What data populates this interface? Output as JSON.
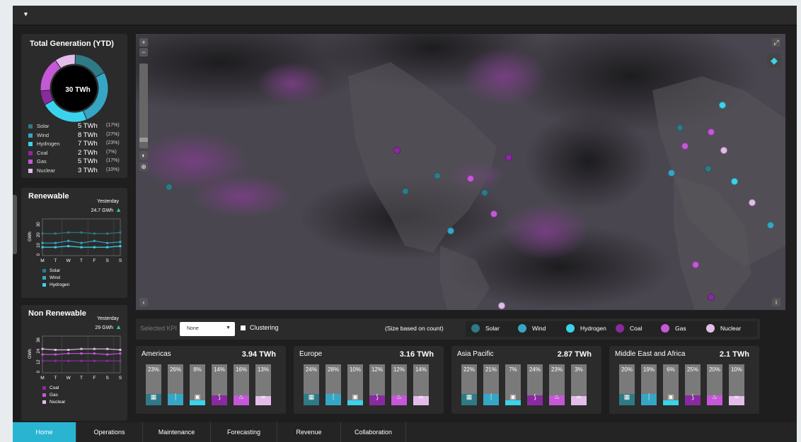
{
  "total_generation": {
    "title": "Total Generation (YTD)",
    "center_label": "30 TWh",
    "legend": [
      {
        "name": "Solar",
        "value": "5 TWh",
        "pct": "(17%)",
        "color": "#2e7a86"
      },
      {
        "name": "Wind",
        "value": "8 TWh",
        "pct": "(27%)",
        "color": "#36a6c4"
      },
      {
        "name": "Hydrogen",
        "value": "7 TWh",
        "pct": "(23%)",
        "color": "#3ad3ec"
      },
      {
        "name": "Coal",
        "value": "2 TWh",
        "pct": "(7%)",
        "color": "#8a2aa0"
      },
      {
        "name": "Gas",
        "value": "5 TWh",
        "pct": "(17%)",
        "color": "#c458d6"
      },
      {
        "name": "Nuclear",
        "value": "3 TWh",
        "pct": "(10%)",
        "color": "#e3bde9"
      }
    ],
    "shares": [
      17,
      27,
      23,
      7,
      17,
      10
    ]
  },
  "renewable": {
    "title": "Renewable",
    "yesterday_label": "Yesterday",
    "yesterday_value": "24.7 GWh",
    "ylabel": "GWh",
    "yticks": [
      "30",
      "20",
      "10",
      "0"
    ],
    "days": [
      "M",
      "T",
      "W",
      "T",
      "F",
      "S",
      "S"
    ],
    "ylim": [
      0,
      35
    ],
    "series": [
      {
        "name": "Solar",
        "color": "#2e7a86",
        "values": [
          21,
          21,
          22,
          22,
          21,
          21,
          22
        ]
      },
      {
        "name": "Wind",
        "color": "#36a6c4",
        "values": [
          12,
          12,
          14,
          12,
          14,
          12,
          13
        ]
      },
      {
        "name": "Hydrogen",
        "color": "#3ad3ec",
        "values": [
          8,
          8,
          9,
          8,
          8,
          8,
          9
        ]
      }
    ]
  },
  "non_renewable": {
    "title": "Non Renewable",
    "yesterday_label": "Yesterday",
    "yesterday_value": "29 GWh",
    "ylabel": "GWh",
    "yticks": [
      "36",
      "24",
      "12",
      "0"
    ],
    "days": [
      "M",
      "T",
      "W",
      "T",
      "F",
      "S",
      "S"
    ],
    "ylim": [
      0,
      40
    ],
    "series": [
      {
        "name": "Coal",
        "color": "#8a2aa0",
        "values": [
          13,
          13,
          13,
          13,
          13,
          13,
          13
        ]
      },
      {
        "name": "Gas",
        "color": "#c458d6",
        "values": [
          20,
          20,
          21,
          21,
          21,
          20,
          21
        ]
      },
      {
        "name": "Nuclear",
        "color": "#e3bde9",
        "values": [
          26,
          25,
          25,
          26,
          26,
          26,
          25
        ]
      }
    ]
  },
  "map": {
    "zoom_in": "+",
    "zoom_out": "−",
    "info": "i"
  },
  "kpi_bar": {
    "selected_kpi_label": "Selected KPI",
    "selected_kpi_value": "None",
    "clustering_label": "Clustering",
    "size_note": "(Size based on count)",
    "legend": [
      {
        "name": "Solar",
        "color": "#2e7a86"
      },
      {
        "name": "Wind",
        "color": "#36a6c4"
      },
      {
        "name": "Hydrogen",
        "color": "#3ad3ec"
      },
      {
        "name": "Coal",
        "color": "#8a2aa0"
      },
      {
        "name": "Gas",
        "color": "#c458d6"
      },
      {
        "name": "Nuclear",
        "color": "#e3bde9"
      }
    ]
  },
  "regions": [
    {
      "name": "Americas",
      "value": "3.94 TWh",
      "pcts": [
        "23%",
        "26%",
        "8%",
        "14%",
        "16%",
        "13%"
      ]
    },
    {
      "name": "Europe",
      "value": "3.16 TWh",
      "pcts": [
        "24%",
        "28%",
        "10%",
        "12%",
        "12%",
        "14%"
      ]
    },
    {
      "name": "Asia Pacific",
      "value": "2.87 TWh",
      "pcts": [
        "22%",
        "21%",
        "7%",
        "24%",
        "23%",
        "3%"
      ]
    },
    {
      "name": "Middle East and Africa",
      "value": "2.1  TWh",
      "pcts": [
        "20%",
        "19%",
        "6%",
        "25%",
        "20%",
        "10%"
      ]
    }
  ],
  "bar_fill_levels": [
    0.28,
    0.28,
    0.12,
    0.25,
    0.24,
    0.22
  ],
  "bar_icons": [
    "solar-panel-icon",
    "wind-turbine-icon",
    "hydrogen-icon",
    "coal-icon",
    "gas-flame-icon",
    "nuclear-icon"
  ],
  "nav": {
    "tabs": [
      "Home",
      "Operations",
      "Maintenance",
      "Forecasting",
      "Revenue",
      "Collaboration"
    ],
    "active": "Home"
  }
}
